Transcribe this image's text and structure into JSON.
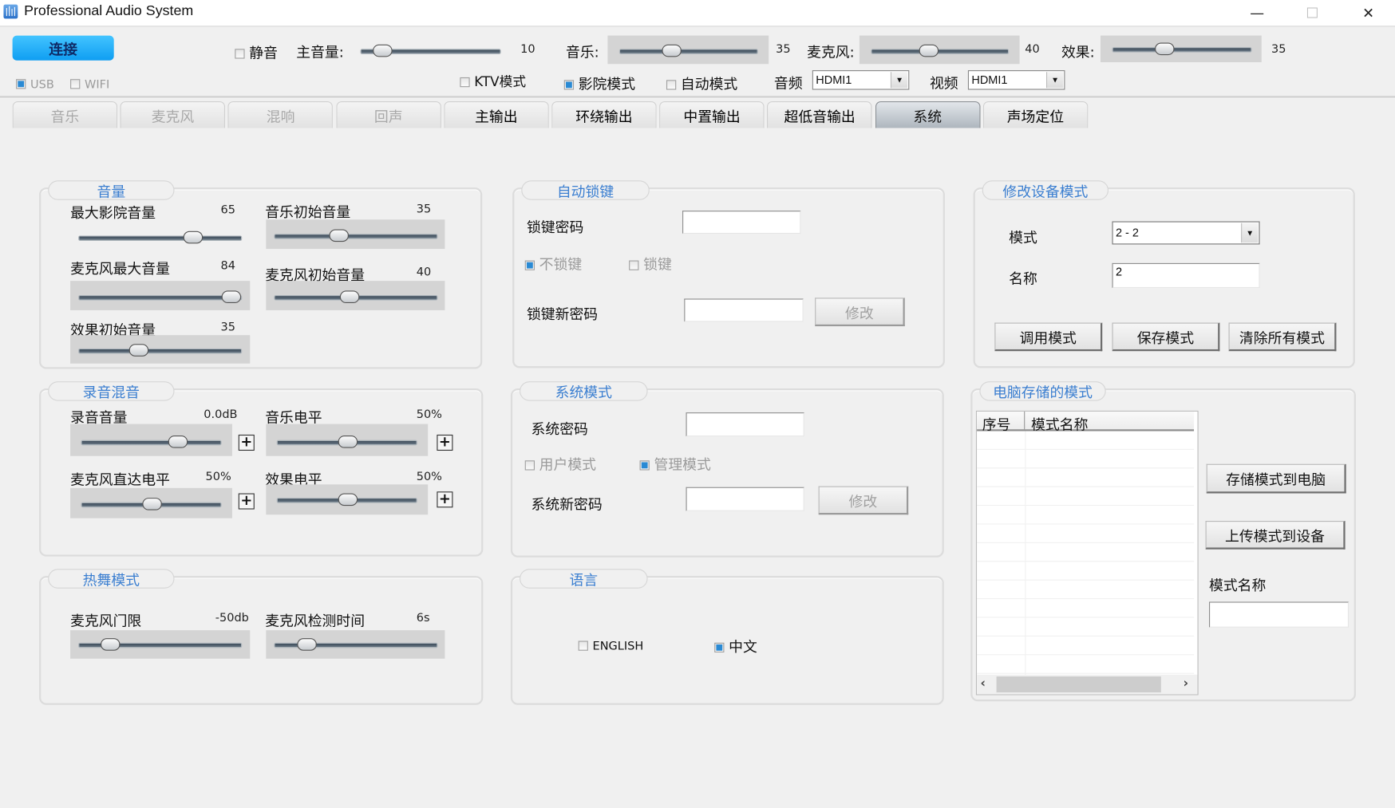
{
  "window": {
    "title": "Professional Audio System",
    "controls": {
      "minimize": "—",
      "maximize": "☐",
      "close": "✕"
    }
  },
  "toolbar": {
    "connect_label": "连接",
    "usb": {
      "label": "USB",
      "checked": true
    },
    "wifi": {
      "label": "WIFI",
      "checked": false
    },
    "mute": {
      "label": "静音",
      "checked": false
    },
    "master_volume": {
      "label": "主音量:",
      "value": "10",
      "fraction": 0.1
    },
    "music": {
      "label": "音乐:",
      "value": "35",
      "fraction": 0.35
    },
    "mic": {
      "label": "麦克风:",
      "value": "40",
      "fraction": 0.4
    },
    "effect": {
      "label": "效果:",
      "value": "35",
      "fraction": 0.35
    },
    "ktv_mode": {
      "label": "KTV模式",
      "checked": false
    },
    "cinema_mode": {
      "label": "影院模式",
      "checked": true
    },
    "auto_mode": {
      "label": "自动模式",
      "checked": false
    },
    "audio": {
      "label": "音频",
      "selected": "HDMI1"
    },
    "video": {
      "label": "视频",
      "selected": "HDMI1"
    }
  },
  "tabs": [
    {
      "label": "音乐",
      "enabled": false
    },
    {
      "label": "麦克风",
      "enabled": false
    },
    {
      "label": "混响",
      "enabled": false
    },
    {
      "label": "回声",
      "enabled": false
    },
    {
      "label": "主输出",
      "enabled": true
    },
    {
      "label": "环绕输出",
      "enabled": true
    },
    {
      "label": "中置输出",
      "enabled": true
    },
    {
      "label": "超低音输出",
      "enabled": true
    },
    {
      "label": "系统",
      "enabled": true,
      "active": true
    },
    {
      "label": "声场定位",
      "enabled": true
    }
  ],
  "volume_group": {
    "title": "音量",
    "max_cinema": {
      "label": "最大影院音量",
      "value": "65",
      "fraction": 0.72
    },
    "music_init": {
      "label": "音乐初始音量",
      "value": "35",
      "fraction": 0.38
    },
    "mic_max": {
      "label": "麦克风最大音量",
      "value": "84",
      "fraction": 0.98
    },
    "mic_init": {
      "label": "麦克风初始音量",
      "value": "40",
      "fraction": 0.45
    },
    "effect_init": {
      "label": "效果初始音量",
      "value": "35",
      "fraction": 0.35
    }
  },
  "record_group": {
    "title": "录音混音",
    "record_volume": {
      "label": "录音音量",
      "value": "0.0dB",
      "fraction": 0.71
    },
    "music_level": {
      "label": "音乐电平",
      "value": "50%",
      "fraction": 0.5
    },
    "mic_direct": {
      "label": "麦克风直达电平",
      "value": "50%",
      "fraction": 0.5
    },
    "effect_level": {
      "label": "效果电平",
      "value": "50%",
      "fraction": 0.5
    },
    "plus": "+"
  },
  "dance_group": {
    "title": "热舞模式",
    "mic_gate": {
      "label": "麦克风门限",
      "value": "-50db",
      "fraction": 0.15
    },
    "mic_detect": {
      "label": "麦克风检测时间",
      "value": "6s",
      "fraction": 0.16
    }
  },
  "autolock_group": {
    "title": "自动锁键",
    "password_label": "锁键密码",
    "password_value": "",
    "no_lock": {
      "label": "不锁键",
      "checked": true
    },
    "lock": {
      "label": "锁键",
      "checked": false
    },
    "new_password_label": "锁键新密码",
    "new_password_value": "",
    "modify_label": "修改"
  },
  "system_group": {
    "title": "系统模式",
    "password_label": "系统密码",
    "password_value": "",
    "user_mode": {
      "label": "用户模式",
      "checked": false
    },
    "admin_mode": {
      "label": "管理模式",
      "checked": true
    },
    "new_password_label": "系统新密码",
    "new_password_value": "",
    "modify_label": "修改"
  },
  "language_group": {
    "title": "语言",
    "english": {
      "label": "ENGLISH",
      "checked": false
    },
    "chinese": {
      "label": "中文",
      "checked": true
    }
  },
  "device_mode_group": {
    "title": "修改设备模式",
    "mode_label": "模式",
    "mode_selected": "2 - 2",
    "name_label": "名称",
    "name_value": "2",
    "recall_label": "调用模式",
    "save_label": "保存模式",
    "clear_label": "清除所有模式"
  },
  "pc_modes_group": {
    "title": "电脑存储的模式",
    "columns": [
      "序号",
      "模式名称"
    ],
    "rows": [],
    "save_to_pc_label": "存储模式到电脑",
    "upload_to_device_label": "上传模式到设备",
    "mode_name_label": "模式名称",
    "mode_name_value": ""
  }
}
